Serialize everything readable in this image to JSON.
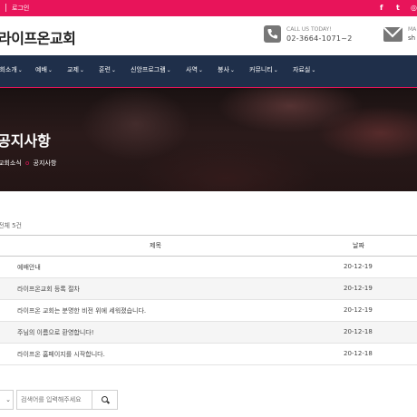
{
  "topbar": {
    "login_label": "로그인",
    "social": [
      {
        "name": "facebook-icon",
        "glyph": "f"
      },
      {
        "name": "twitter-icon",
        "glyph": "t"
      },
      {
        "name": "instagram-icon",
        "glyph": "◎"
      }
    ],
    "accent_color": "#e8145a"
  },
  "header": {
    "logo_text": "라이프온교회",
    "call_label": "CALL US TODAY!",
    "call_number": "02-3664-1071~2",
    "mail_label": "MA",
    "mail_value": "sh"
  },
  "nav": {
    "items": [
      {
        "label": "교회소개"
      },
      {
        "label": "예배"
      },
      {
        "label": "교제"
      },
      {
        "label": "훈련"
      },
      {
        "label": "신앙프로그램"
      },
      {
        "label": "사역"
      },
      {
        "label": "봉사"
      },
      {
        "label": "커뮤니티"
      },
      {
        "label": "자료실"
      }
    ],
    "chevron": "⌄",
    "bg_color": "#1f2f4a"
  },
  "hero": {
    "title": "공지사항",
    "breadcrumb_parent": "교회소식",
    "breadcrumb_sep": "o",
    "breadcrumb_current": "공지사항"
  },
  "board": {
    "count_text": "전체 5건",
    "columns": {
      "title": "제목",
      "date": "날짜"
    },
    "rows": [
      {
        "title": "예배안내",
        "date": "20-12-19"
      },
      {
        "title": "라이프온교회 등록 절차",
        "date": "20-12-19"
      },
      {
        "title": "라이프온 교회는 분명한 비전 위에 세워졌습니다.",
        "date": "20-12-19"
      },
      {
        "title": "주님의 이름으로 환영합니다!",
        "date": "20-12-18"
      },
      {
        "title": "라이프온 홈페이지를 시작합니다.",
        "date": "20-12-18"
      }
    ]
  },
  "search": {
    "select_value": "⌄",
    "placeholder": "검색어를 입력해주세요"
  }
}
